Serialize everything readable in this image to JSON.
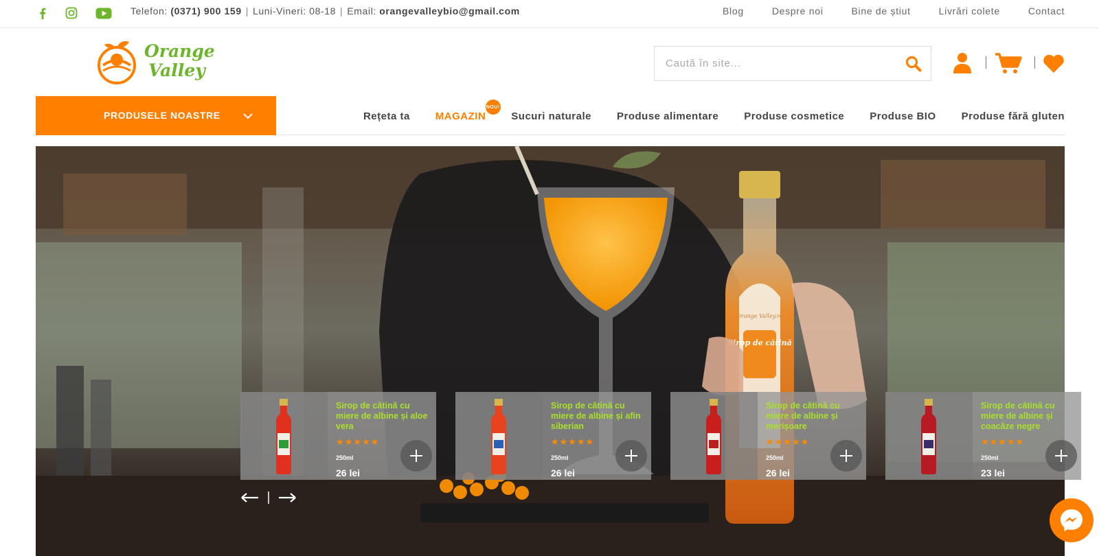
{
  "topbar": {
    "phone_label": "Telefon:",
    "phone": "(0371) 900 159",
    "hours": "Luni-Vineri: 08-18",
    "email_label": "Email:",
    "email": "orangevalleybio@gmail.com",
    "links": [
      "Blog",
      "Despre noi",
      "Bine de știut",
      "Livrări colete",
      "Contact"
    ],
    "social_icons": [
      "facebook-icon",
      "instagram-icon",
      "youtube-icon"
    ]
  },
  "logo": {
    "line1": "Orange",
    "line2": "Valley"
  },
  "search": {
    "placeholder": "Caută în site..."
  },
  "header_icons": [
    "user-icon",
    "cart-icon",
    "heart-icon"
  ],
  "nav": {
    "products_button": "PRODUSELE NOASTRE",
    "items": [
      "Rețeta ta",
      "MAGAZIN",
      "Sucuri naturale",
      "Produse alimentare",
      "Produse cosmetice",
      "Produse BIO",
      "Produse fără gluten"
    ],
    "active_index": 1,
    "badge": "NOU!"
  },
  "hero": {
    "bottle_label": "Sirop de cătină",
    "bottle_brand": "Orange Valley.ro"
  },
  "products": [
    {
      "name": "Sirop de cătină cu miere de albine și aloe vera",
      "rating": 5,
      "volume": "250ml",
      "price": "26 lei",
      "accent": "#2e9b3a"
    },
    {
      "name": "Sirop de cătină cu miere de albine și afin siberian",
      "rating": 5,
      "volume": "250ml",
      "price": "26 lei",
      "accent": "#2b5fb5"
    },
    {
      "name": "Sirop de cătină cu miere de albine și merișoare",
      "rating": 5,
      "volume": "250ml",
      "price": "26 lei",
      "accent": "#b81f1f"
    },
    {
      "name": "Sirop de cătină cu miere de albine și coacăze negre",
      "rating": 5,
      "volume": "250ml",
      "price": "23 lei",
      "accent": "#3a2c6b"
    }
  ],
  "colors": {
    "accent": "#ff7f00",
    "brand_green": "#6db52a",
    "product_name": "#a8e02c"
  }
}
